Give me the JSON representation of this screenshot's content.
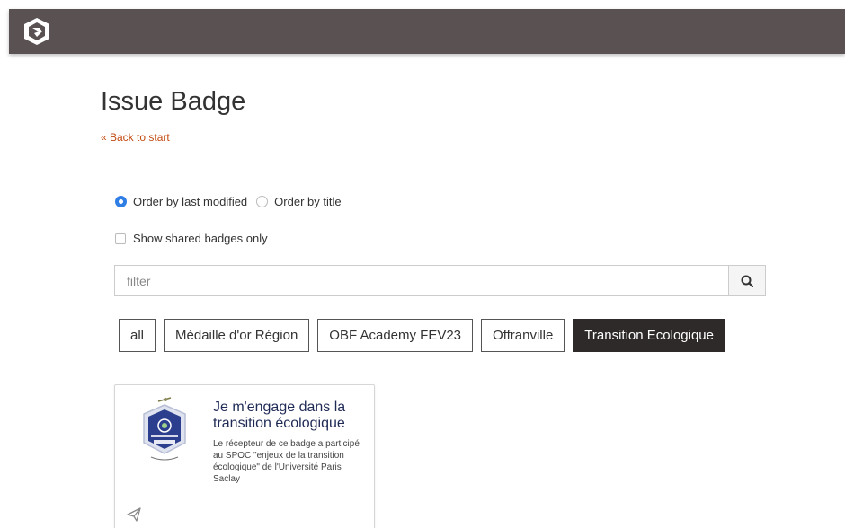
{
  "header": {
    "logo_icon": "app-logo-icon",
    "bar_color": "#5a5252"
  },
  "page": {
    "title": "Issue Badge",
    "back_link": "« Back to start"
  },
  "ordering": {
    "options": [
      {
        "label": "Order by last modified",
        "checked": true
      },
      {
        "label": "Order by title",
        "checked": false
      }
    ]
  },
  "shared_filter": {
    "label": "Show shared badges only",
    "checked": false
  },
  "filter": {
    "placeholder": "filter",
    "value": ""
  },
  "tags": [
    {
      "label": "all",
      "active": false
    },
    {
      "label": "Médaille d'or Région",
      "active": false
    },
    {
      "label": "OBF Academy FEV23",
      "active": false
    },
    {
      "label": "Offranville",
      "active": false
    },
    {
      "label": "Transition Ecologique",
      "active": true
    }
  ],
  "badge": {
    "title": "Je m'engage dans la transition écologique",
    "description": "Le récepteur de ce badge a participé au SPOC \"enjeux de la transition écologique\" de l'Université Paris Saclay",
    "icon": "paper-plane-icon"
  },
  "colors": {
    "accent": "#2f7ee6",
    "link": "#c24a10",
    "active_tag": "#2f2a2a"
  }
}
